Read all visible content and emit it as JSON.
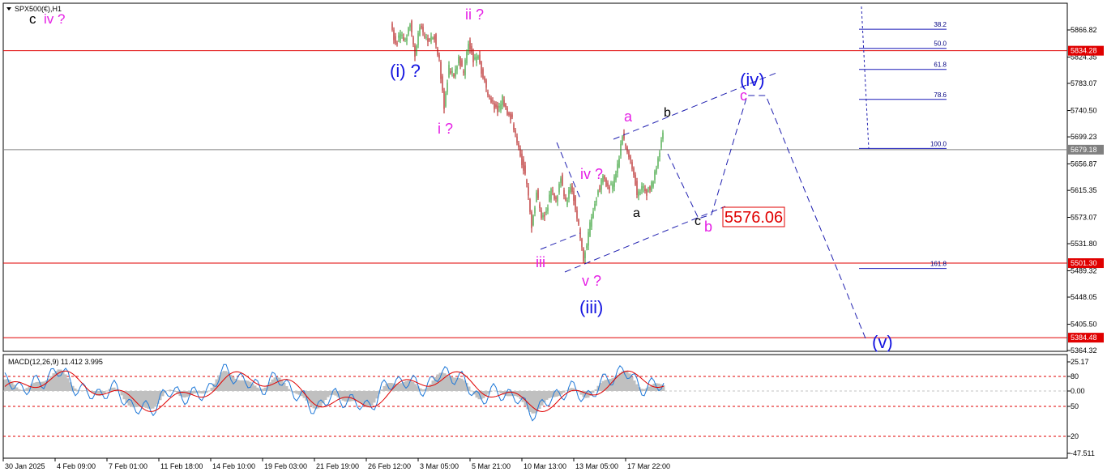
{
  "chart_data": {
    "type": "candlestick",
    "symbol_label": "SPX500(€),H1",
    "top_left_labels": [
      {
        "text": "c",
        "color": "#000000"
      },
      {
        "text": "iv ?",
        "color": "#e51fe5"
      }
    ],
    "ylim": [
      5364.32,
      5881.0
    ],
    "price_ticks": [
      "5866.82",
      "5824.35",
      "5783.07",
      "5740.50",
      "5699.23",
      "5656.87",
      "5615.35",
      "5573.07",
      "5531.80",
      "5489.32",
      "5448.05",
      "5405.50",
      "5364.32"
    ],
    "time_ticks": [
      "30 Jan 2025",
      "4 Feb 09:00",
      "7 Feb 01:00",
      "11 Feb 18:00",
      "14 Feb 10:00",
      "19 Feb 03:00",
      "21 Feb 19:00",
      "26 Feb 12:00",
      "3 Mar 05:00",
      "5 Mar 21:00",
      "10 Mar 13:00",
      "13 Mar 05:00",
      "17 Mar 22:00"
    ],
    "horizontal_levels": [
      {
        "price": 5834.28,
        "label": "5834.28",
        "color": "#e00000"
      },
      {
        "price": 5679.18,
        "label": "5679.18",
        "color": "#808080"
      },
      {
        "price": 5501.3,
        "label": "5501.30",
        "color": "#e00000"
      },
      {
        "price": 5384.48,
        "label": "5384.48",
        "color": "#e00000"
      }
    ],
    "fib_levels": [
      {
        "label": "38.2",
        "price": 5868.0
      },
      {
        "label": "50.0",
        "price": 5838.0
      },
      {
        "label": "61.8",
        "price": 5805.0
      },
      {
        "label": "78.6",
        "price": 5758.0
      },
      {
        "label": "100.0",
        "price": 5681.0
      },
      {
        "label": "161.8",
        "price": 5493.0
      }
    ],
    "price_callout": "5576.06",
    "wave_labels_big": [
      "(i) ?",
      "(iii)",
      "(iv)",
      "(v)"
    ],
    "wave_labels_pink": [
      "ii ?",
      "i ?",
      "iii",
      "iv ?",
      "v ?",
      "a",
      "c",
      "b"
    ],
    "wave_labels_black": [
      "b",
      "a",
      "c"
    ],
    "macd": {
      "label": "MACD(12,26,9) 11.412 3.995",
      "ticks": [
        "25.17",
        "80",
        "0.00",
        "50",
        "20",
        "-47.511"
      ],
      "ylim": [
        -47.511,
        25.17
      ]
    }
  }
}
